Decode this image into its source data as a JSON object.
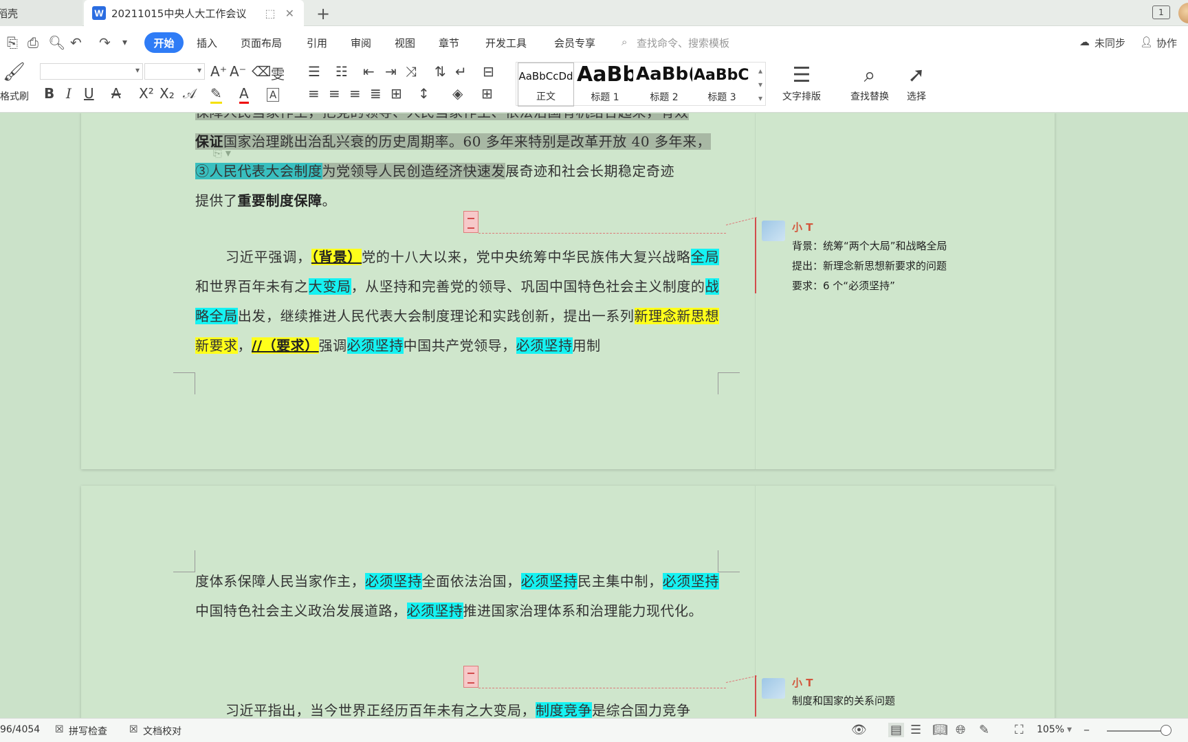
{
  "tabs": {
    "home_label": "稻壳",
    "doc_title": "20211015中央人大工作会议",
    "doc_icon_letter": "W",
    "new_tab": "+",
    "window_badge": "1"
  },
  "menu": {
    "items": [
      "开始",
      "插入",
      "页面布局",
      "引用",
      "审阅",
      "视图",
      "章节",
      "开发工具",
      "会员专享"
    ],
    "search_placeholder": "查找命令、搜索模板",
    "sync_label": "未同步",
    "collab_label": "协作"
  },
  "ribbon": {
    "format_painter": "格式刷",
    "styles": [
      {
        "sample": "AaBbCcDd",
        "label": "正文"
      },
      {
        "sample": "AaBb",
        "label": "标题 1"
      },
      {
        "sample": "AaBb(",
        "label": "标题 2"
      },
      {
        "sample": "AaBbC(",
        "label": "标题 3"
      }
    ],
    "text_layout": "文字排版",
    "find_replace": "查找替换",
    "select": "选择"
  },
  "page1": {
    "line1": "保障人民当家作主，把党的领导、人民当家作主、依法治国有机结合起来，有效",
    "line2_bold": "保证",
    "line2_rest": "国家治理跳出治乱兴衰的历史周期率。60 多年来特别是改革开放 40 多年来，",
    "line3_teal": "③人民代表大会制度",
    "line3_sel": "为党领导人民创造经济快速发",
    "line3_rest": "展奇迹和社会长期稳定奇迹",
    "line4_a": "提供了",
    "line4_bold": "重要制度保障",
    "line4_end": "。",
    "p2_a": "习近平强调，",
    "p2_bg": "（背景）",
    "p2_b": "党的十八大以来，党中央统筹中华民族伟大复兴战略",
    "p2_c": "全局",
    "p2_d": "和世界百年未有之",
    "p2_e": "大变局",
    "p2_f": "，从坚持和完善党的领导、巩固中国特色社会主义",
    "p2_g": "制度的",
    "p2_h": "战略全局",
    "p2_i": "出发，继续推进人民代表大会制度理论和实践创新，提出一系列",
    "p2_j": "新理念新思想新要求",
    "p2_k": "，",
    "p2_l": "//（要求）",
    "p2_m": "强调",
    "p2_n": "必须坚持",
    "p2_o": "中国共产党领导，",
    "p2_p": "必须坚持",
    "p2_q": "用制"
  },
  "comment1": {
    "author": "小 T",
    "lines": [
      "背景：统筹“两个大局”和战略全局",
      "提出：新理念新思想新要求的问题",
      "要求：6 个“必须坚持”"
    ]
  },
  "page2": {
    "a": "度体系保障人民当家作主，",
    "b": "必须坚持",
    "c": "全面依法治国，",
    "d": "必须坚持",
    "e": "民主集中制，",
    "f": "必须",
    "g": "坚持",
    "h": "中国特色社会主义政治发展道路，",
    "i": "必须坚持",
    "j": "推进国家治理体系和治理能力现",
    "k": "代化。",
    "p2_a": "习近平指出，当今世界正经历百年未有之大变局，",
    "p2_b": "制度竞争",
    "p2_c": "是综合国力竞争"
  },
  "comment2": {
    "author": "小 T",
    "lines": [
      "制度和国家的关系问题"
    ]
  },
  "status": {
    "word_count": "96/4054",
    "spell_check": "拼写检查",
    "doc_proof": "文档校对",
    "zoom": "105%"
  },
  "colors": {
    "accent": "#2f7cf6",
    "highlight_cyan": "#15f2f2",
    "highlight_yellow": "#ffff1a",
    "comment_red": "#d24c4c",
    "page_bg": "#cfe6cc"
  }
}
